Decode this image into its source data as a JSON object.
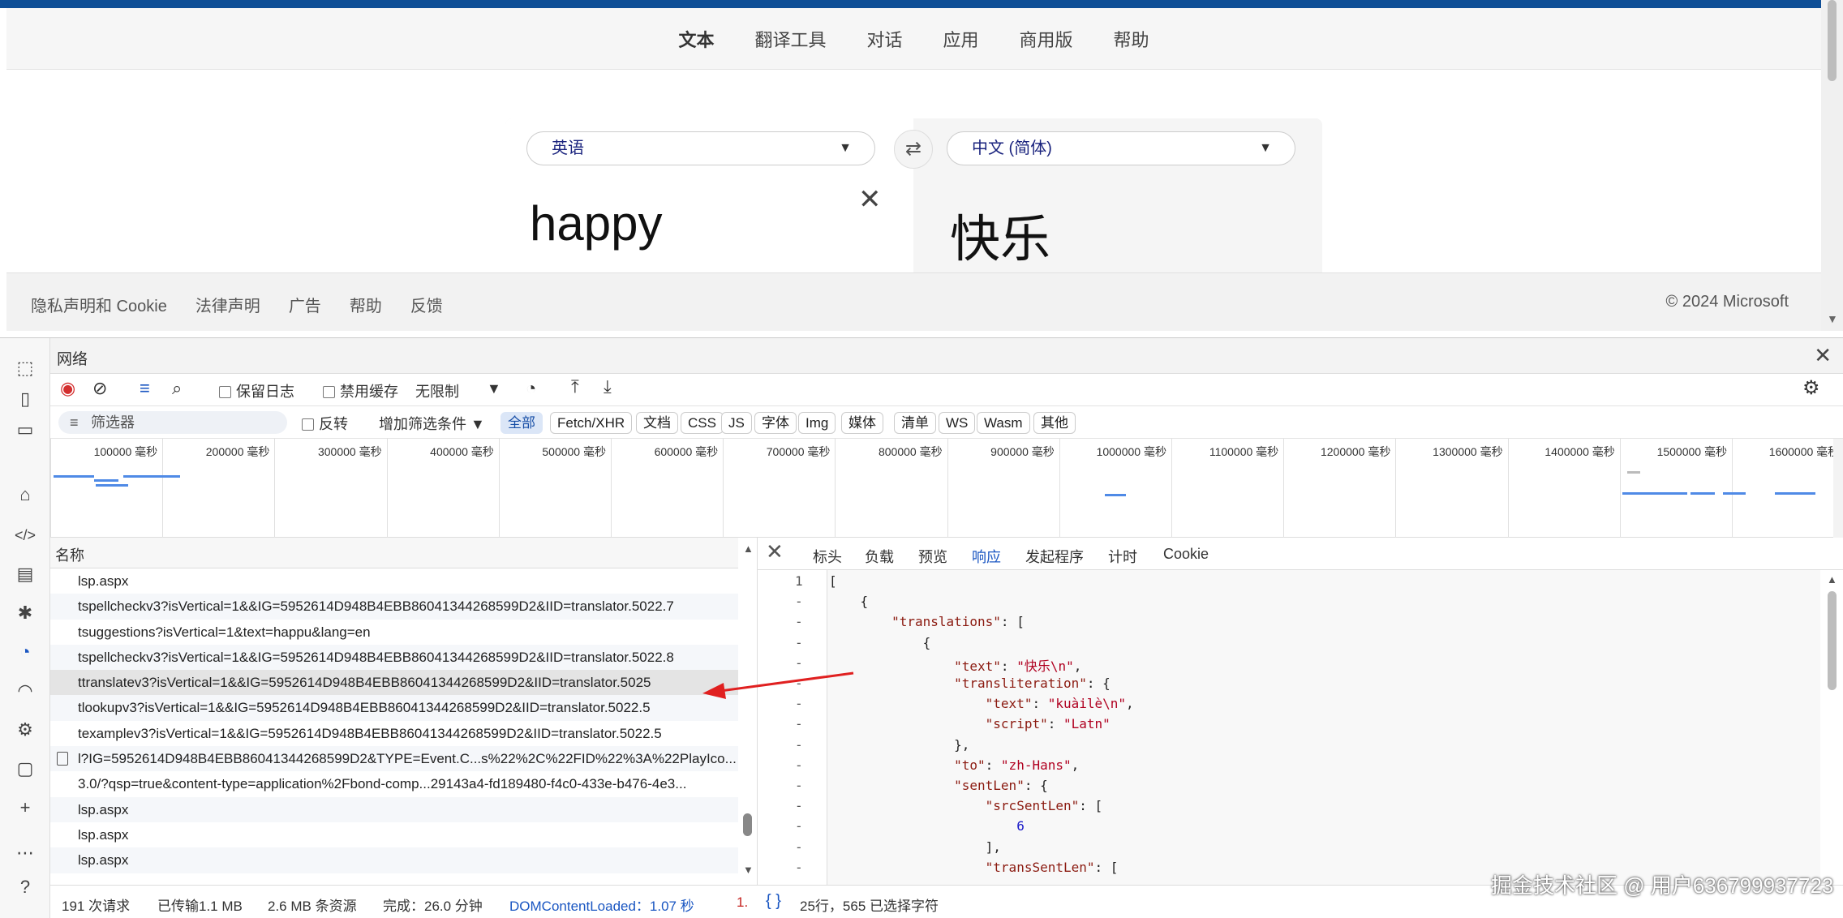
{
  "nav": {
    "items": [
      "文本",
      "翻译工具",
      "对话",
      "应用",
      "商用版",
      "帮助"
    ]
  },
  "translator": {
    "source_lang": "英语",
    "target_lang": "中文 (简体)",
    "source_text": "happy",
    "target_text": "快乐"
  },
  "footer": {
    "links": [
      "隐私声明和 Cookie",
      "法律声明",
      "广告",
      "帮助",
      "反馈"
    ],
    "copyright": "© 2024 Microsoft"
  },
  "devtools": {
    "panel_title": "网络",
    "toolbar": {
      "preserve_log": "保留日志",
      "disable_cache": "禁用缓存",
      "throttle": "无限制"
    },
    "filter": {
      "placeholder": "筛选器",
      "invert": "反转",
      "more_filters": "增加筛选条件",
      "types": [
        "全部",
        "Fetch/XHR",
        "文档",
        "CSS",
        "JS",
        "字体",
        "Img",
        "媒体",
        "清单",
        "WS",
        "Wasm",
        "其他"
      ]
    },
    "timeline_ticks": [
      "100000 毫秒",
      "200000 毫秒",
      "300000 毫秒",
      "400000 毫秒",
      "500000 毫秒",
      "600000 毫秒",
      "700000 毫秒",
      "800000 毫秒",
      "900000 毫秒",
      "1000000 毫秒",
      "1100000 毫秒",
      "1200000 毫秒",
      "1300000 毫秒",
      "1400000 毫秒",
      "1500000 毫秒",
      "1600000 毫秒"
    ],
    "list_header": "名称",
    "requests": [
      "lsp.aspx",
      "tspellcheckv3?isVertical=1&&IG=5952614D948B4EBB86041344268599D2&IID=translator.5022.7",
      "tsuggestions?isVertical=1&text=happu&lang=en",
      "tspellcheckv3?isVertical=1&&IG=5952614D948B4EBB86041344268599D2&IID=translator.5022.8",
      "ttranslatev3?isVertical=1&&IG=5952614D948B4EBB86041344268599D2&IID=translator.5025",
      "tlookupv3?isVertical=1&&IG=5952614D948B4EBB86041344268599D2&IID=translator.5022.5",
      "texamplev3?isVertical=1&&IG=5952614D948B4EBB86041344268599D2&IID=translator.5022.5",
      "l?IG=5952614D948B4EBB86041344268599D2&TYPE=Event.C...s%22%2C%22FID%22%3A%22PlayIco...",
      "3.0/?qsp=true&content-type=application%2Fbond-comp...29143a4-fd189480-f4c0-433e-b476-4e3...",
      "lsp.aspx",
      "lsp.aspx",
      "lsp.aspx"
    ],
    "detail_tabs": [
      "标头",
      "负载",
      "预览",
      "响应",
      "发起程序",
      "计时",
      "Cookie"
    ],
    "response_lines": [
      {
        "ln": "1",
        "text": "["
      },
      {
        "ln": "-",
        "text": "    {"
      },
      {
        "ln": "-",
        "text": "        \"translations\": ["
      },
      {
        "ln": "-",
        "text": "            {"
      },
      {
        "ln": "-",
        "text": "                \"text\": \"快乐\\n\","
      },
      {
        "ln": "-",
        "text": "                \"transliteration\": {"
      },
      {
        "ln": "-",
        "text": "                    \"text\": \"kuàilè\\n\","
      },
      {
        "ln": "-",
        "text": "                    \"script\": \"Latn\""
      },
      {
        "ln": "-",
        "text": "                },"
      },
      {
        "ln": "-",
        "text": "                \"to\": \"zh-Hans\","
      },
      {
        "ln": "-",
        "text": "                \"sentLen\": {"
      },
      {
        "ln": "-",
        "text": "                    \"srcSentLen\": ["
      },
      {
        "ln": "-",
        "text": "                        6"
      },
      {
        "ln": "-",
        "text": "                    ],"
      },
      {
        "ln": "-",
        "text": "                    \"transSentLen\": ["
      }
    ],
    "status": {
      "requests": "191 次请求",
      "transferred": "已传输1.1 MB",
      "resources": "2.6 MB 条资源",
      "finish": "完成：26.0 分钟",
      "dcl": "DOMContentLoaded：1.07 秒",
      "load": "1.",
      "selection": "25行，565 已选择字符"
    }
  },
  "watermark": "掘金技术社区 @ 用户636799937723"
}
